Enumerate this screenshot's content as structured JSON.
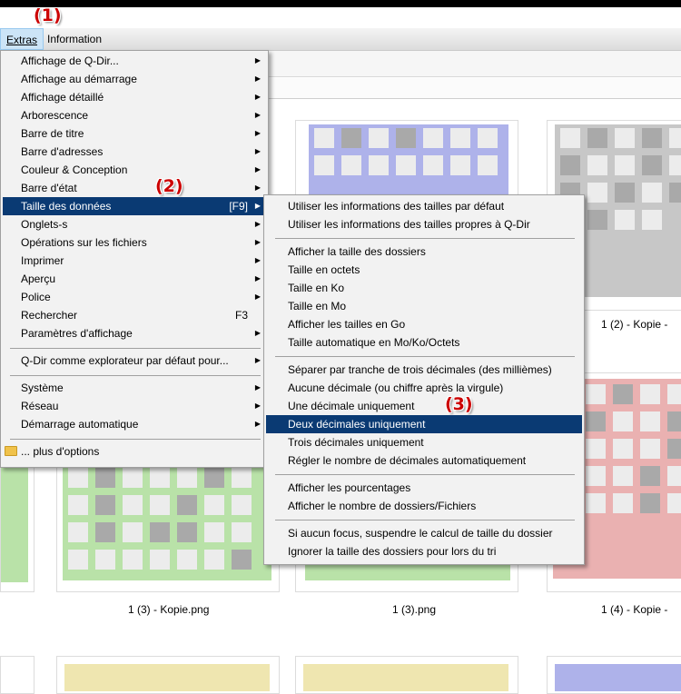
{
  "annotations": {
    "a1": "(1)",
    "a2": "(2)",
    "a3": "(3)"
  },
  "menubar": {
    "extras": "Extras",
    "information": "Information"
  },
  "thumbnails": [
    {
      "label": "1 (2) - Kopie - "
    },
    {
      "label": "1 (3) - Kopie.png"
    },
    {
      "label": "1 (3).png"
    },
    {
      "label": "1 (4) - Kopie - "
    }
  ],
  "menu": {
    "items": [
      {
        "label": "Affichage de Q-Dir...",
        "shortcut": "",
        "arrow": "▶"
      },
      {
        "label": "Affichage au démarrage",
        "shortcut": "",
        "arrow": "▶"
      },
      {
        "label": "Affichage détaillé",
        "shortcut": "",
        "arrow": "▶"
      },
      {
        "label": "Arborescence",
        "shortcut": "",
        "arrow": "▶"
      },
      {
        "label": "Barre de titre",
        "shortcut": "",
        "arrow": "▶"
      },
      {
        "label": "Barre d'adresses",
        "shortcut": "",
        "arrow": "▶"
      },
      {
        "label": "Couleur & Conception",
        "shortcut": "",
        "arrow": "▶"
      },
      {
        "label": "Barre d'état",
        "shortcut": "",
        "arrow": "▶"
      },
      {
        "label": "Taille des données",
        "shortcut": "[F9]",
        "arrow": "▶"
      },
      {
        "label": "Onglets-s",
        "shortcut": "",
        "arrow": "▶"
      },
      {
        "label": "Opérations sur les fichiers",
        "shortcut": "",
        "arrow": "▶"
      },
      {
        "label": "Imprimer",
        "shortcut": "",
        "arrow": "▶"
      },
      {
        "label": "Aperçu",
        "shortcut": "",
        "arrow": "▶"
      },
      {
        "label": "Police",
        "shortcut": "",
        "arrow": "▶"
      },
      {
        "label": "Rechercher",
        "shortcut": "F3",
        "arrow": "▶"
      },
      {
        "label": "Paramètres d'affichage",
        "shortcut": "",
        "arrow": "▶"
      },
      {
        "label": "Q-Dir comme explorateur par défaut pour...",
        "shortcut": "",
        "arrow": "▶"
      },
      {
        "label": "Système",
        "shortcut": "",
        "arrow": "▶"
      },
      {
        "label": "Réseau",
        "shortcut": "",
        "arrow": "▶"
      },
      {
        "label": "Démarrage automatique",
        "shortcut": "",
        "arrow": "▶"
      },
      {
        "label": "... plus d'options",
        "shortcut": "",
        "arrow": ""
      }
    ]
  },
  "submenu": {
    "items": [
      {
        "label": "Utiliser les informations des tailles par défaut"
      },
      {
        "label": "Utiliser les informations des tailles propres à Q-Dir"
      },
      {
        "label": "Afficher la taille des dossiers"
      },
      {
        "label": "Taille en octets"
      },
      {
        "label": "Taille en Ko"
      },
      {
        "label": "Taille en Mo"
      },
      {
        "label": "Afficher les tailles en Go"
      },
      {
        "label": "Taille automatique en Mo/Ko/Octets"
      },
      {
        "label": "Séparer par tranche de trois décimales (des millièmes)"
      },
      {
        "label": "Aucune décimale (ou chiffre après la virgule)"
      },
      {
        "label": "Une décimale uniquement"
      },
      {
        "label": "Deux décimales uniquement"
      },
      {
        "label": "Trois décimales uniquement"
      },
      {
        "label": "Régler le nombre de décimales automatiquement"
      },
      {
        "label": "Afficher les pourcentages"
      },
      {
        "label": "Afficher le nombre de dossiers/Fichiers"
      },
      {
        "label": "Si aucun focus, suspendre le calcul de taille du dossier"
      },
      {
        "label": "Ignorer la taille des dossiers pour lors du tri"
      }
    ]
  },
  "colors": {
    "selection": "#0a3a73",
    "annotation": "#cc0000",
    "thumb_purple": "#aeb2ea",
    "thumb_gray": "#c7c7c7",
    "thumb_green": "#b9e2a8",
    "thumb_red": "#eab1b1",
    "thumb_yellow": "#efe6b0"
  }
}
